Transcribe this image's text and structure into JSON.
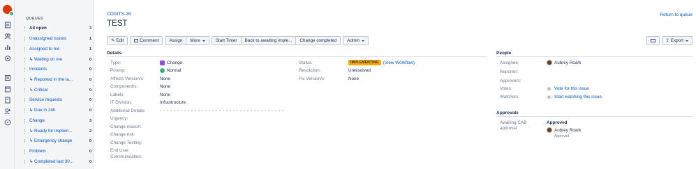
{
  "queues": {
    "header": "QUEUES",
    "items": [
      {
        "label": "All open",
        "count": "3"
      },
      {
        "label": "Unassigned issues",
        "count": "1"
      },
      {
        "label": "Assigned to me",
        "count": "1"
      },
      {
        "label": "↳ Waiting on me",
        "count": "0"
      },
      {
        "label": "Incidents",
        "count": "0"
      },
      {
        "label": "↳ Reported in the la...",
        "count": "0"
      },
      {
        "label": "↳ Critical",
        "count": "0"
      },
      {
        "label": "Service requests",
        "count": "0"
      },
      {
        "label": "↳ Due in 24h",
        "count": "0"
      },
      {
        "label": "Change",
        "count": "3"
      },
      {
        "label": "↳ Ready for implem...",
        "count": "2"
      },
      {
        "label": "↳ Emergency change",
        "count": "0"
      },
      {
        "label": "Problem",
        "count": "0"
      },
      {
        "label": "↳ Completed last 30...",
        "count": "0"
      }
    ]
  },
  "issue": {
    "key": "COGITS-26",
    "title": "TEST",
    "return_link": "Return to queue"
  },
  "toolbar": {
    "edit": "Edit",
    "comment": "Comment",
    "assign": "Assign",
    "more": "More",
    "start_timer": "Start Timer",
    "back_awaiting": "Back to awaiting imple...",
    "change_completed": "Change completed",
    "admin": "Admin",
    "export": "Export"
  },
  "details": {
    "heading": "Details",
    "left": [
      {
        "label": "Type:",
        "value": "Change"
      },
      {
        "label": "Priority:",
        "value": "Normal"
      },
      {
        "label": "Affects Version/s:",
        "value": "None"
      },
      {
        "label": "Component/s:",
        "value": "None"
      },
      {
        "label": "Labels:",
        "value": "None"
      },
      {
        "label": "IT Division:",
        "value": "Infrastructure"
      },
      {
        "label": "Additional Details:",
        "value": ""
      },
      {
        "label": "Urgency:",
        "value": ""
      },
      {
        "label": "Change reason:",
        "value": ""
      },
      {
        "label": "Change risk:",
        "value": ""
      },
      {
        "label": "Change Testing:",
        "value": ""
      },
      {
        "label": "End User",
        "value": ""
      },
      {
        "label": "Communication:",
        "value": ""
      }
    ],
    "right": [
      {
        "label": "Status:",
        "value": "IMPLEMENTING",
        "link": "(View Workflow)"
      },
      {
        "label": "Resolution:",
        "value": "Unresolved"
      },
      {
        "label": "Fix Version/s:",
        "value": "None"
      }
    ]
  },
  "people": {
    "heading": "People",
    "assignee_label": "Assignee:",
    "assignee": "Aubrey Roark",
    "reporter_label": "Reporter:",
    "approvers_label": "Approvers:",
    "votes_label": "Votes:",
    "votes_count": "0",
    "votes_link": "Vote for this issue",
    "watchers_label": "Watchers:",
    "watchers_count": "0",
    "watchers_link": "Start watching this issue"
  },
  "approvals": {
    "heading": "Approvals",
    "label_line1": "Awaiting CAB",
    "label_line2": "approval",
    "status": "Approved",
    "approver": "Aubrey Roark",
    "approver_status": "Approved"
  },
  "colors": {
    "link": "#0052cc",
    "status_badge": "#ffab00",
    "priority": "#36b37e",
    "change_type": "#904ee2"
  }
}
